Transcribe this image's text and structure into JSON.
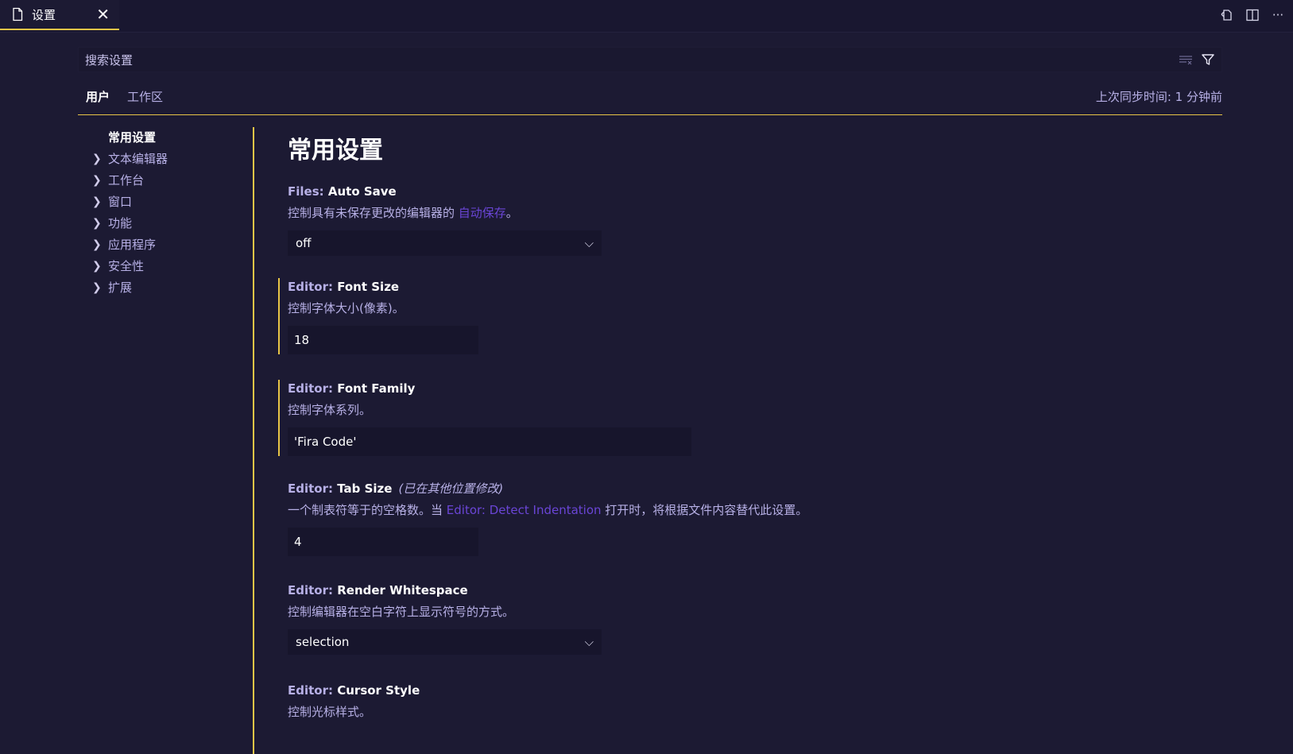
{
  "tab": {
    "label": "设置"
  },
  "search": {
    "placeholder": "搜索设置"
  },
  "scope_tabs": {
    "user": "用户",
    "workspace": "工作区"
  },
  "sync_status": "上次同步时间: 1 分钟前",
  "toc": [
    {
      "label": "常用设置",
      "active": true
    },
    {
      "label": "文本编辑器"
    },
    {
      "label": "工作台"
    },
    {
      "label": "窗口"
    },
    {
      "label": "功能"
    },
    {
      "label": "应用程序"
    },
    {
      "label": "安全性"
    },
    {
      "label": "扩展"
    }
  ],
  "page_title": "常用设置",
  "settings": {
    "auto_save": {
      "category": "Files: ",
      "key": "Auto Save",
      "desc_before": "控制具有未保存更改的编辑器的 ",
      "desc_link": "自动保存",
      "desc_after": "。",
      "value": "off"
    },
    "font_size": {
      "category": "Editor: ",
      "key": "Font Size",
      "desc": "控制字体大小(像素)。",
      "value": "18"
    },
    "font_family": {
      "category": "Editor: ",
      "key": "Font Family",
      "desc": "控制字体系列。",
      "value": "'Fira Code'"
    },
    "tab_size": {
      "category": "Editor: ",
      "key": "Tab Size",
      "modified_note": "(已在其他位置修改)",
      "desc_before": "一个制表符等于的空格数。当 ",
      "desc_link": "Editor: Detect Indentation",
      "desc_after": " 打开时，将根据文件内容替代此设置。",
      "value": "4"
    },
    "render_whitespace": {
      "category": "Editor: ",
      "key": "Render Whitespace",
      "desc": "控制编辑器在空白字符上显示符号的方式。",
      "value": "selection"
    },
    "cursor_style": {
      "category": "Editor: ",
      "key": "Cursor Style",
      "desc": "控制光标样式。"
    }
  },
  "colors": {
    "accent": "#e8c547",
    "background": "#1c1a33",
    "link": "#6a45d6",
    "muted_text": "#b7b0e6"
  }
}
